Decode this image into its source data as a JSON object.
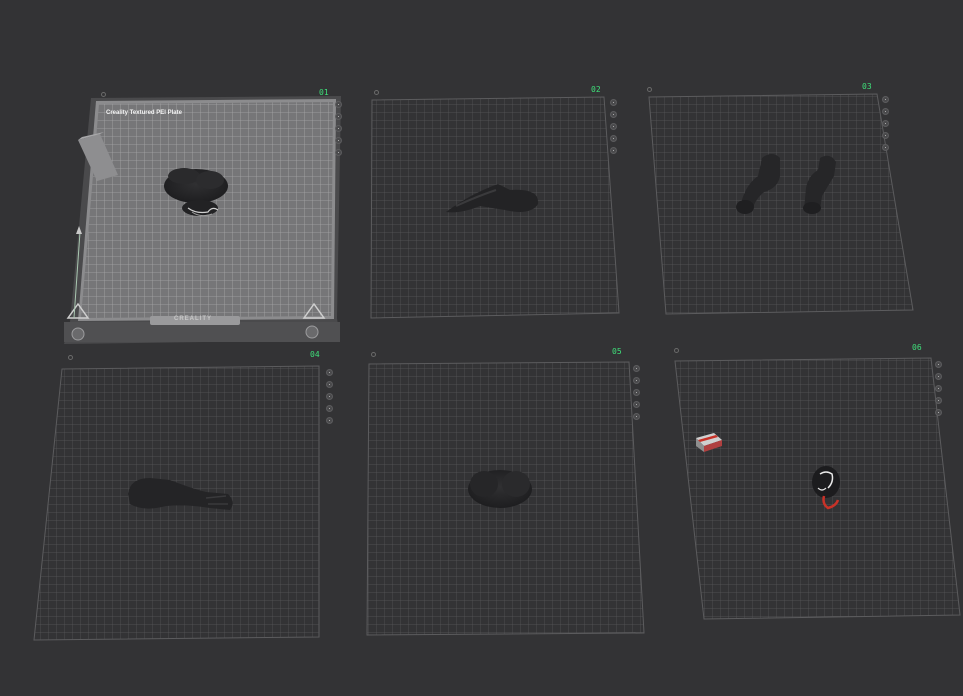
{
  "plates": [
    {
      "number": "01",
      "label": "Creality Textured PEI Plate",
      "brand": "CREALITY",
      "active": true
    },
    {
      "number": "02"
    },
    {
      "number": "03"
    },
    {
      "number": "04"
    },
    {
      "number": "05"
    },
    {
      "number": "06"
    }
  ],
  "plate_toolbar_icons": [
    "close-icon",
    "arrange-icon",
    "orient-icon",
    "lock-icon",
    "settings-icon"
  ],
  "colors": {
    "background": "#333335",
    "grid_line": "#6e6e70",
    "plate_number": "#3fe07a",
    "active_plate": "#8a8a8c",
    "model": "#262628",
    "model_accent_red": "#c83228"
  }
}
